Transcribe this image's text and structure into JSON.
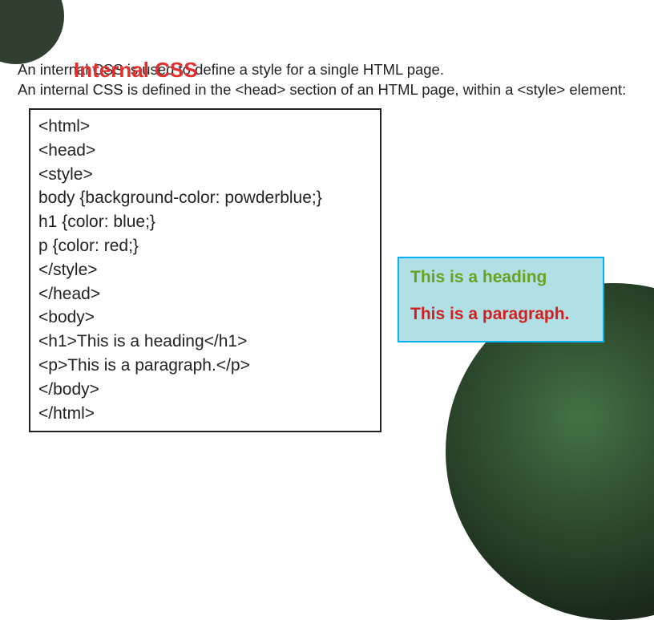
{
  "title": "Internal CSS",
  "intro_line1": "An internal CSS is used to define a style for a single HTML page.",
  "intro_line2": "An internal CSS is defined in the <head> section of an HTML page, within a <style> element:",
  "code": {
    "l1": "<html>",
    "l2": "<head>",
    "l3": "<style>",
    "l4": "body {background-color: powderblue;}",
    "l5": "h1   {color: blue;}",
    "l6": "p    {color: red;}",
    "l7": "</style>",
    "l8": "</head>",
    "l9": "<body>",
    "l10": "<h1>This is a heading</h1>",
    "l11": "<p>This is a paragraph.</p>",
    "l12": "</body>",
    "l13": "</html>"
  },
  "output": {
    "heading": "This is a heading",
    "paragraph": "This is a paragraph."
  }
}
